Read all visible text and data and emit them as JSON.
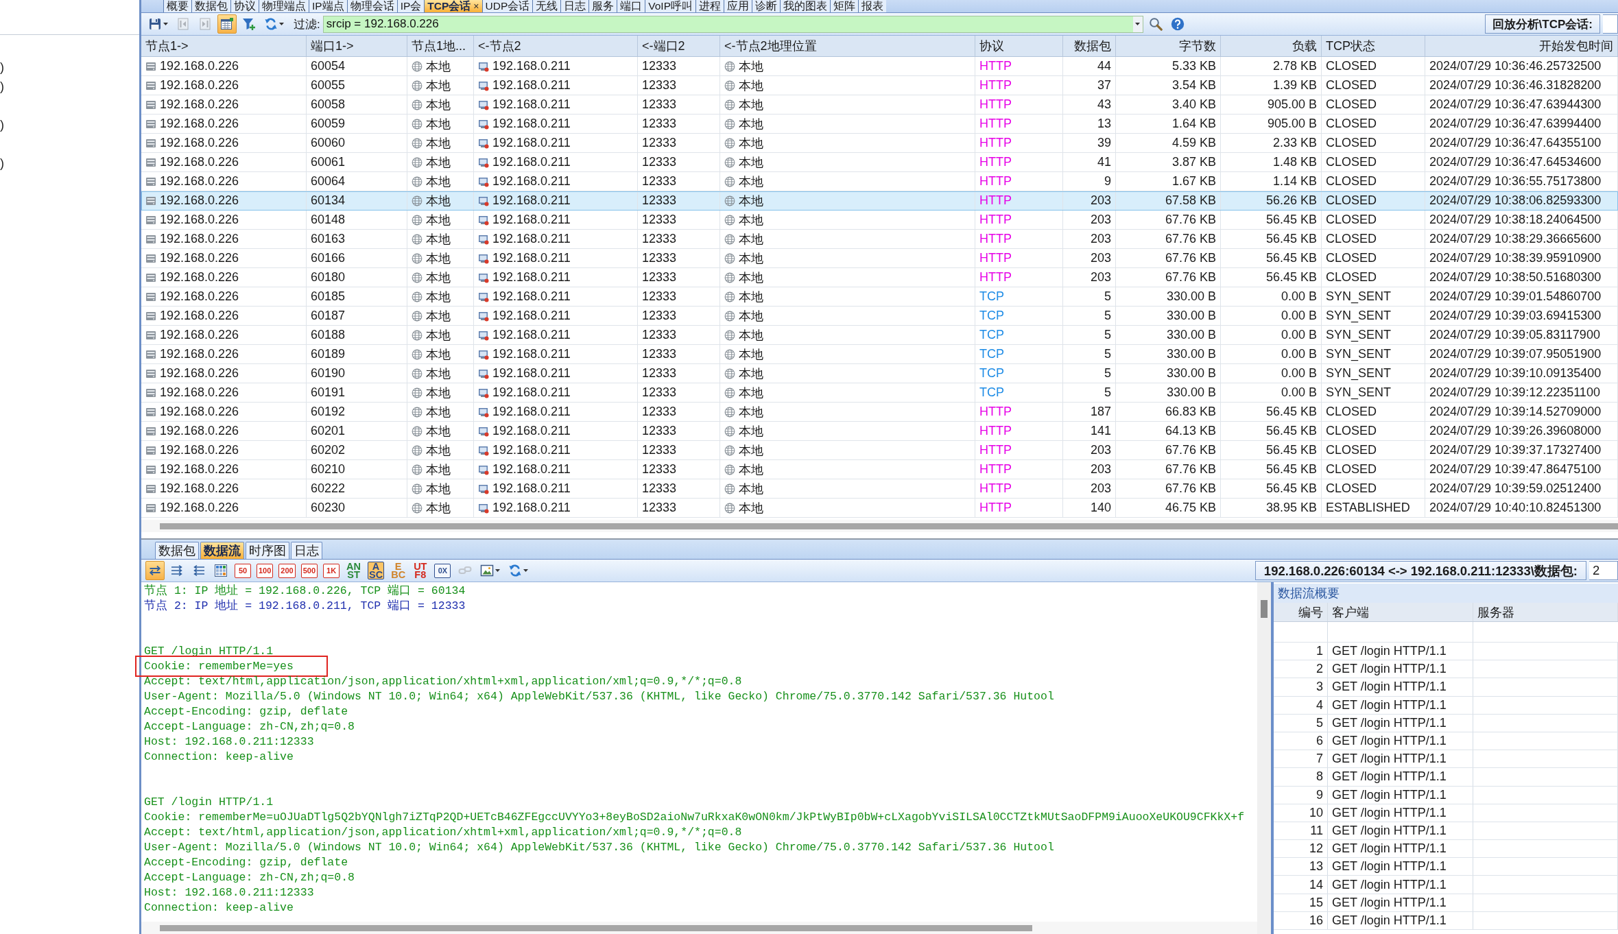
{
  "left_panel": {
    "rows": [
      {
        "text": ")"
      },
      {
        "text": ")"
      },
      {},
      {
        "text": ")"
      },
      {},
      {
        "text": ")"
      }
    ]
  },
  "top_tabs": [
    {
      "label": "概要",
      "selected": false
    },
    {
      "label": "数据包",
      "selected": false
    },
    {
      "label": "协议",
      "selected": false
    },
    {
      "label": "物理端点",
      "selected": false
    },
    {
      "label": "IP端点",
      "selected": false
    },
    {
      "label": "物理会话",
      "selected": false
    },
    {
      "label": "IP会",
      "selected": false
    },
    {
      "label": "TCP会话",
      "selected": true,
      "close": "×"
    },
    {
      "label": "UDP会话",
      "selected": false
    },
    {
      "label": "无线",
      "selected": false
    },
    {
      "label": "日志",
      "selected": false
    },
    {
      "label": "服务",
      "selected": false
    },
    {
      "label": "端口",
      "selected": false
    },
    {
      "label": "VoIP呼叫",
      "selected": false
    },
    {
      "label": "进程",
      "selected": false
    },
    {
      "label": "应用",
      "selected": false
    },
    {
      "label": "诊断",
      "selected": false
    },
    {
      "label": "我的图表",
      "selected": false
    },
    {
      "label": "矩阵",
      "selected": false
    },
    {
      "label": "报表",
      "selected": false
    }
  ],
  "toolbar": {
    "buttons": [
      {
        "kind": "save",
        "on": false,
        "disabled": false,
        "dropdown": true
      },
      {
        "kind": "previous",
        "on": false,
        "disabled": true,
        "dropdown": false
      },
      {
        "kind": "next",
        "on": false,
        "disabled": true,
        "dropdown": false
      },
      {
        "kind": "chart",
        "on": true,
        "disabled": false,
        "dropdown": false
      },
      {
        "kind": "filter",
        "on": false,
        "disabled": false,
        "dropdown": false
      },
      {
        "kind": "refresh",
        "on": false,
        "disabled": false,
        "dropdown": true
      }
    ],
    "filter_label": "过滤:",
    "filter_value": "srcip = 192.168.0.226",
    "path_label": "回放分析\\TCP会话:"
  },
  "table": {
    "columns": [
      {
        "label": "节点1->",
        "kind": "host"
      },
      {
        "label": "端口1->",
        "kind": "text"
      },
      {
        "label": "节点1地...",
        "kind": "place"
      },
      {
        "label": "<-节点2",
        "kind": "remote-host"
      },
      {
        "label": "<-端口2",
        "kind": "text"
      },
      {
        "label": "<-节点2地理位置",
        "kind": "place"
      },
      {
        "label": "协议",
        "kind": "protocol"
      },
      {
        "label": "数据包",
        "kind": "number"
      },
      {
        "label": "字节数",
        "kind": "number"
      },
      {
        "label": "负载",
        "kind": "number"
      },
      {
        "label": "TCP状态",
        "kind": "text"
      },
      {
        "label": "开始发包时间",
        "kind": "time"
      }
    ],
    "rows": [
      {
        "selected": false,
        "color": "#e600e6",
        "cells": [
          "192.168.0.226",
          "60054",
          "本地",
          "192.168.0.211",
          "12333",
          "本地",
          "HTTP",
          "44",
          "5.33 KB",
          "2.78 KB",
          "CLOSED",
          "2024/07/29 10:36:46.25732500"
        ]
      },
      {
        "selected": false,
        "color": "#e600e6",
        "cells": [
          "192.168.0.226",
          "60055",
          "本地",
          "192.168.0.211",
          "12333",
          "本地",
          "HTTP",
          "37",
          "3.54 KB",
          "1.39 KB",
          "CLOSED",
          "2024/07/29 10:36:46.31828200"
        ]
      },
      {
        "selected": false,
        "color": "#e600e6",
        "cells": [
          "192.168.0.226",
          "60058",
          "本地",
          "192.168.0.211",
          "12333",
          "本地",
          "HTTP",
          "43",
          "3.40 KB",
          "905.00 B",
          "CLOSED",
          "2024/07/29 10:36:47.63944300"
        ]
      },
      {
        "selected": false,
        "color": "#e600e6",
        "cells": [
          "192.168.0.226",
          "60059",
          "本地",
          "192.168.0.211",
          "12333",
          "本地",
          "HTTP",
          "13",
          "1.64 KB",
          "905.00 B",
          "CLOSED",
          "2024/07/29 10:36:47.63994400"
        ]
      },
      {
        "selected": false,
        "color": "#e600e6",
        "cells": [
          "192.168.0.226",
          "60060",
          "本地",
          "192.168.0.211",
          "12333",
          "本地",
          "HTTP",
          "39",
          "4.59 KB",
          "2.33 KB",
          "CLOSED",
          "2024/07/29 10:36:47.64355100"
        ]
      },
      {
        "selected": false,
        "color": "#e600e6",
        "cells": [
          "192.168.0.226",
          "60061",
          "本地",
          "192.168.0.211",
          "12333",
          "本地",
          "HTTP",
          "41",
          "3.87 KB",
          "1.48 KB",
          "CLOSED",
          "2024/07/29 10:36:47.64534600"
        ]
      },
      {
        "selected": false,
        "color": "#e600e6",
        "cells": [
          "192.168.0.226",
          "60064",
          "本地",
          "192.168.0.211",
          "12333",
          "本地",
          "HTTP",
          "9",
          "1.67 KB",
          "1.14 KB",
          "CLOSED",
          "2024/07/29 10:36:55.75173800"
        ]
      },
      {
        "selected": true,
        "color": "#e600e6",
        "cells": [
          "192.168.0.226",
          "60134",
          "本地",
          "192.168.0.211",
          "12333",
          "本地",
          "HTTP",
          "203",
          "67.58 KB",
          "56.26 KB",
          "CLOSED",
          "2024/07/29 10:38:06.82593300"
        ]
      },
      {
        "selected": false,
        "color": "#e600e6",
        "cells": [
          "192.168.0.226",
          "60148",
          "本地",
          "192.168.0.211",
          "12333",
          "本地",
          "HTTP",
          "203",
          "67.76 KB",
          "56.45 KB",
          "CLOSED",
          "2024/07/29 10:38:18.24064500"
        ]
      },
      {
        "selected": false,
        "color": "#e600e6",
        "cells": [
          "192.168.0.226",
          "60163",
          "本地",
          "192.168.0.211",
          "12333",
          "本地",
          "HTTP",
          "203",
          "67.76 KB",
          "56.45 KB",
          "CLOSED",
          "2024/07/29 10:38:29.36665600"
        ]
      },
      {
        "selected": false,
        "color": "#e600e6",
        "cells": [
          "192.168.0.226",
          "60166",
          "本地",
          "192.168.0.211",
          "12333",
          "本地",
          "HTTP",
          "203",
          "67.76 KB",
          "56.45 KB",
          "CLOSED",
          "2024/07/29 10:38:39.95910900"
        ]
      },
      {
        "selected": false,
        "color": "#e600e6",
        "cells": [
          "192.168.0.226",
          "60180",
          "本地",
          "192.168.0.211",
          "12333",
          "本地",
          "HTTP",
          "203",
          "67.76 KB",
          "56.45 KB",
          "CLOSED",
          "2024/07/29 10:38:50.51680300"
        ]
      },
      {
        "selected": false,
        "color": "#1e8ce6",
        "cells": [
          "192.168.0.226",
          "60185",
          "本地",
          "192.168.0.211",
          "12333",
          "本地",
          "TCP",
          "5",
          "330.00 B",
          "0.00 B",
          "SYN_SENT",
          "2024/07/29 10:39:01.54860700"
        ]
      },
      {
        "selected": false,
        "color": "#1e8ce6",
        "cells": [
          "192.168.0.226",
          "60187",
          "本地",
          "192.168.0.211",
          "12333",
          "本地",
          "TCP",
          "5",
          "330.00 B",
          "0.00 B",
          "SYN_SENT",
          "2024/07/29 10:39:03.69415300"
        ]
      },
      {
        "selected": false,
        "color": "#1e8ce6",
        "cells": [
          "192.168.0.226",
          "60188",
          "本地",
          "192.168.0.211",
          "12333",
          "本地",
          "TCP",
          "5",
          "330.00 B",
          "0.00 B",
          "SYN_SENT",
          "2024/07/29 10:39:05.83117900"
        ]
      },
      {
        "selected": false,
        "color": "#1e8ce6",
        "cells": [
          "192.168.0.226",
          "60189",
          "本地",
          "192.168.0.211",
          "12333",
          "本地",
          "TCP",
          "5",
          "330.00 B",
          "0.00 B",
          "SYN_SENT",
          "2024/07/29 10:39:07.95051900"
        ]
      },
      {
        "selected": false,
        "color": "#1e8ce6",
        "cells": [
          "192.168.0.226",
          "60190",
          "本地",
          "192.168.0.211",
          "12333",
          "本地",
          "TCP",
          "5",
          "330.00 B",
          "0.00 B",
          "SYN_SENT",
          "2024/07/29 10:39:10.09135400"
        ]
      },
      {
        "selected": false,
        "color": "#1e8ce6",
        "cells": [
          "192.168.0.226",
          "60191",
          "本地",
          "192.168.0.211",
          "12333",
          "本地",
          "TCP",
          "5",
          "330.00 B",
          "0.00 B",
          "SYN_SENT",
          "2024/07/29 10:39:12.22351100"
        ]
      },
      {
        "selected": false,
        "color": "#e600e6",
        "cells": [
          "192.168.0.226",
          "60192",
          "本地",
          "192.168.0.211",
          "12333",
          "本地",
          "HTTP",
          "187",
          "66.83 KB",
          "56.45 KB",
          "CLOSED",
          "2024/07/29 10:39:14.52709000"
        ]
      },
      {
        "selected": false,
        "color": "#e600e6",
        "cells": [
          "192.168.0.226",
          "60201",
          "本地",
          "192.168.0.211",
          "12333",
          "本地",
          "HTTP",
          "141",
          "64.13 KB",
          "56.45 KB",
          "CLOSED",
          "2024/07/29 10:39:26.39608000"
        ]
      },
      {
        "selected": false,
        "color": "#e600e6",
        "cells": [
          "192.168.0.226",
          "60202",
          "本地",
          "192.168.0.211",
          "12333",
          "本地",
          "HTTP",
          "203",
          "67.76 KB",
          "56.45 KB",
          "CLOSED",
          "2024/07/29 10:39:37.17327400"
        ]
      },
      {
        "selected": false,
        "color": "#e600e6",
        "cells": [
          "192.168.0.226",
          "60210",
          "本地",
          "192.168.0.211",
          "12333",
          "本地",
          "HTTP",
          "203",
          "67.76 KB",
          "56.45 KB",
          "CLOSED",
          "2024/07/29 10:39:47.86475100"
        ]
      },
      {
        "selected": false,
        "color": "#e600e6",
        "cells": [
          "192.168.0.226",
          "60222",
          "本地",
          "192.168.0.211",
          "12333",
          "本地",
          "HTTP",
          "203",
          "67.76 KB",
          "56.45 KB",
          "CLOSED",
          "2024/07/29 10:39:59.02512400"
        ]
      },
      {
        "selected": false,
        "color": "#e600e6",
        "cells": [
          "192.168.0.226",
          "60230",
          "本地",
          "192.168.0.211",
          "12333",
          "本地",
          "HTTP",
          "140",
          "46.75 KB",
          "38.95 KB",
          "ESTABLISHED",
          "2024/07/29 10:40:10.82451300"
        ]
      }
    ]
  },
  "lower_tabs": [
    {
      "label": "数据包",
      "selected": false
    },
    {
      "label": "数据流",
      "selected": true
    },
    {
      "label": "时序图",
      "selected": false
    },
    {
      "label": "日志",
      "selected": false
    }
  ],
  "stream_toolbar": {
    "buttons": [
      {
        "kind": "swap",
        "on": true,
        "disabled": false,
        "dropdown": false
      },
      {
        "kind": "order-forward",
        "on": false,
        "disabled": false,
        "dropdown": false
      },
      {
        "kind": "order-backward",
        "on": false,
        "disabled": false,
        "dropdown": false
      },
      {
        "kind": "grid",
        "on": false,
        "disabled": false,
        "dropdown": false
      },
      {
        "kind": "count",
        "label": [
          "50"
        ],
        "color": "#d42a1e",
        "on": false,
        "disabled": false,
        "dropdown": false
      },
      {
        "kind": "count",
        "label": [
          "100"
        ],
        "color": "#d42a1e",
        "on": false,
        "disabled": false,
        "dropdown": false
      },
      {
        "kind": "count",
        "label": [
          "200"
        ],
        "color": "#d42a1e",
        "on": false,
        "disabled": false,
        "dropdown": false
      },
      {
        "kind": "count",
        "label": [
          "500"
        ],
        "color": "#d42a1e",
        "on": false,
        "disabled": false,
        "dropdown": false
      },
      {
        "kind": "count",
        "label": [
          "1K"
        ],
        "color": "#d42a1e",
        "on": false,
        "disabled": false,
        "dropdown": false
      },
      {
        "kind": "encoding",
        "label": [
          "AN",
          "ST"
        ],
        "color": "#2b8a3a",
        "on": false,
        "disabled": false,
        "dropdown": false
      },
      {
        "kind": "encoding",
        "label": [
          "A",
          "SC"
        ],
        "color": "#2a4a8a",
        "on": true,
        "disabled": false,
        "dropdown": false
      },
      {
        "kind": "encoding",
        "label": [
          "E",
          "BC"
        ],
        "color": "#d0842a",
        "on": false,
        "disabled": false,
        "dropdown": false
      },
      {
        "kind": "encoding",
        "label": [
          "UT",
          "F8"
        ],
        "color": "#d42a1e",
        "on": false,
        "disabled": false,
        "dropdown": false
      },
      {
        "kind": "hex",
        "label": [
          "0X"
        ],
        "color": "#2f4f8f",
        "on": false,
        "disabled": false,
        "dropdown": false
      },
      {
        "kind": "link",
        "on": false,
        "disabled": true,
        "dropdown": false
      },
      {
        "kind": "image",
        "on": false,
        "disabled": false,
        "dropdown": true
      },
      {
        "kind": "refresh",
        "on": false,
        "disabled": false,
        "dropdown": true
      }
    ],
    "path_label": "192.168.0.226:60134 <-> 192.168.0.211:12333\\数据包:",
    "packet_value": "2"
  },
  "stream": {
    "header": [
      {
        "text": "节点 1: IP 地址 = 192.168.0.226, TCP 端口 = 60134",
        "color": "#17901a"
      },
      {
        "text": "节点 2: IP 地址 = 192.168.0.211, TCP 端口 = 12333",
        "color": "#1f2fae"
      }
    ],
    "blocks": [
      {
        "color": "#17901a",
        "lines": [
          {
            "text": "GET /login HTTP/1.1",
            "highlighted": false
          },
          {
            "text": "Cookie: rememberMe=yes",
            "highlighted": true
          },
          {
            "text": "Accept: text/html,application/json,application/xhtml+xml,application/xml;q=0.9,*/*;q=0.8",
            "highlighted": false
          },
          {
            "text": "User-Agent: Mozilla/5.0 (Windows NT 10.0; Win64; x64) AppleWebKit/537.36 (KHTML, like Gecko) Chrome/75.0.3770.142 Safari/537.36 Hutool",
            "highlighted": false
          },
          {
            "text": "Accept-Encoding: gzip, deflate",
            "highlighted": false
          },
          {
            "text": "Accept-Language: zh-CN,zh;q=0.8",
            "highlighted": false
          },
          {
            "text": "Host: 192.168.0.211:12333",
            "highlighted": false
          },
          {
            "text": "Connection: keep-alive",
            "highlighted": false
          }
        ]
      },
      {
        "color": "#17901a",
        "lines": [
          {
            "text": "GET /login HTTP/1.1",
            "highlighted": false
          },
          {
            "text": "Cookie: rememberMe=uOJUaDTlg5Q2bYQNlgh7iZTqP2QD+UETcB46ZFEgccUVYYo3+8eyBoSD2aioNw7uRkxaK0wON0km/JkPtWyBIp0bW+cLXagobYviSILSAl0CCTZtkMUtSaoDFPM9iAuooXeUKOU9CFKkX+f",
            "highlighted": false
          },
          {
            "text": "Accept: text/html,application/json,application/xhtml+xml,application/xml;q=0.9,*/*;q=0.8",
            "highlighted": false
          },
          {
            "text": "User-Agent: Mozilla/5.0 (Windows NT 10.0; Win64; x64) AppleWebKit/537.36 (KHTML, like Gecko) Chrome/75.0.3770.142 Safari/537.36 Hutool",
            "highlighted": false
          },
          {
            "text": "Accept-Encoding: gzip, deflate",
            "highlighted": false
          },
          {
            "text": "Accept-Language: zh-CN,zh;q=0.8",
            "highlighted": false
          },
          {
            "text": "Host: 192.168.0.211:12333",
            "highlighted": false
          },
          {
            "text": "Connection: keep-alive",
            "highlighted": false
          }
        ]
      }
    ]
  },
  "summary": {
    "title": "数据流概要",
    "columns": [
      "编号",
      "客户端",
      "服务器"
    ],
    "rows": [
      {
        "number": "1",
        "client": "GET /login HTTP/1.1"
      },
      {
        "number": "2",
        "client": "GET /login HTTP/1.1"
      },
      {
        "number": "3",
        "client": "GET /login HTTP/1.1"
      },
      {
        "number": "4",
        "client": "GET /login HTTP/1.1"
      },
      {
        "number": "5",
        "client": "GET /login HTTP/1.1"
      },
      {
        "number": "6",
        "client": "GET /login HTTP/1.1"
      },
      {
        "number": "7",
        "client": "GET /login HTTP/1.1"
      },
      {
        "number": "8",
        "client": "GET /login HTTP/1.1"
      },
      {
        "number": "9",
        "client": "GET /login HTTP/1.1"
      },
      {
        "number": "10",
        "client": "GET /login HTTP/1.1"
      },
      {
        "number": "11",
        "client": "GET /login HTTP/1.1"
      },
      {
        "number": "12",
        "client": "GET /login HTTP/1.1"
      },
      {
        "number": "13",
        "client": "GET /login HTTP/1.1"
      },
      {
        "number": "14",
        "client": "GET /login HTTP/1.1"
      },
      {
        "number": "15",
        "client": "GET /login HTTP/1.1"
      },
      {
        "number": "16",
        "client": "GET /login HTTP/1.1"
      }
    ]
  }
}
